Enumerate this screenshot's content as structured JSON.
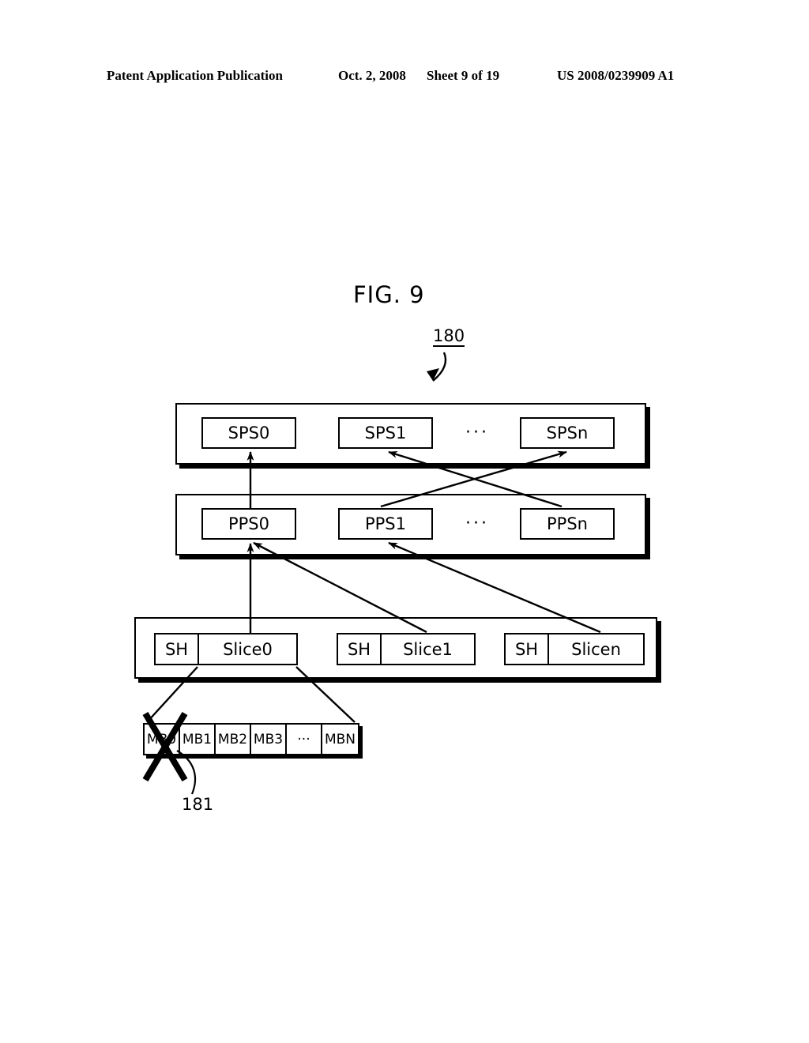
{
  "header": {
    "publication": "Patent Application Publication",
    "date": "Oct. 2, 2008",
    "sheet": "Sheet 9 of 19",
    "patent_number": "US 2008/0239909 A1"
  },
  "figure": {
    "title": "FIG. 9",
    "reference_main": "180",
    "reference_detail": "181"
  },
  "diagram": {
    "type": "block-diagram",
    "rows": [
      {
        "id": "sps",
        "name": "sequence-parameter-set-row",
        "units": [
          "SPS0",
          "SPS1",
          "SPSn"
        ],
        "ellipsis": "···"
      },
      {
        "id": "pps",
        "name": "picture-parameter-set-row",
        "units": [
          "PPS0",
          "PPS1",
          "PPSn"
        ],
        "ellipsis": "···"
      },
      {
        "id": "slice",
        "name": "slice-row",
        "groups": [
          {
            "header": "SH",
            "body": "Slice0"
          },
          {
            "header": "SH",
            "body": "Slice1"
          },
          {
            "header": "SH",
            "body": "Slicen"
          }
        ]
      },
      {
        "id": "mb",
        "name": "macroblock-row",
        "cells": [
          "MB0",
          "MB1",
          "MB2",
          "MB3",
          "···",
          "MBN"
        ]
      }
    ],
    "references": {
      "pps_to_sps": [
        {
          "from": "PPS0",
          "to": "SPS0"
        },
        {
          "from": "PPSn",
          "to": "SPS1"
        },
        {
          "from": "PPS1",
          "to": "SPSn"
        }
      ],
      "slice_to_pps": [
        {
          "from": "Slice0",
          "to": "PPS0"
        },
        {
          "from": "Slice1",
          "to": "PPS0"
        },
        {
          "from": "Slicen",
          "to": "PPS1"
        }
      ]
    },
    "marks": [
      {
        "kind": "cross-out",
        "target": "MB0",
        "label": "181"
      }
    ],
    "colors": {
      "ink": "#000000",
      "paper": "#ffffff"
    }
  }
}
